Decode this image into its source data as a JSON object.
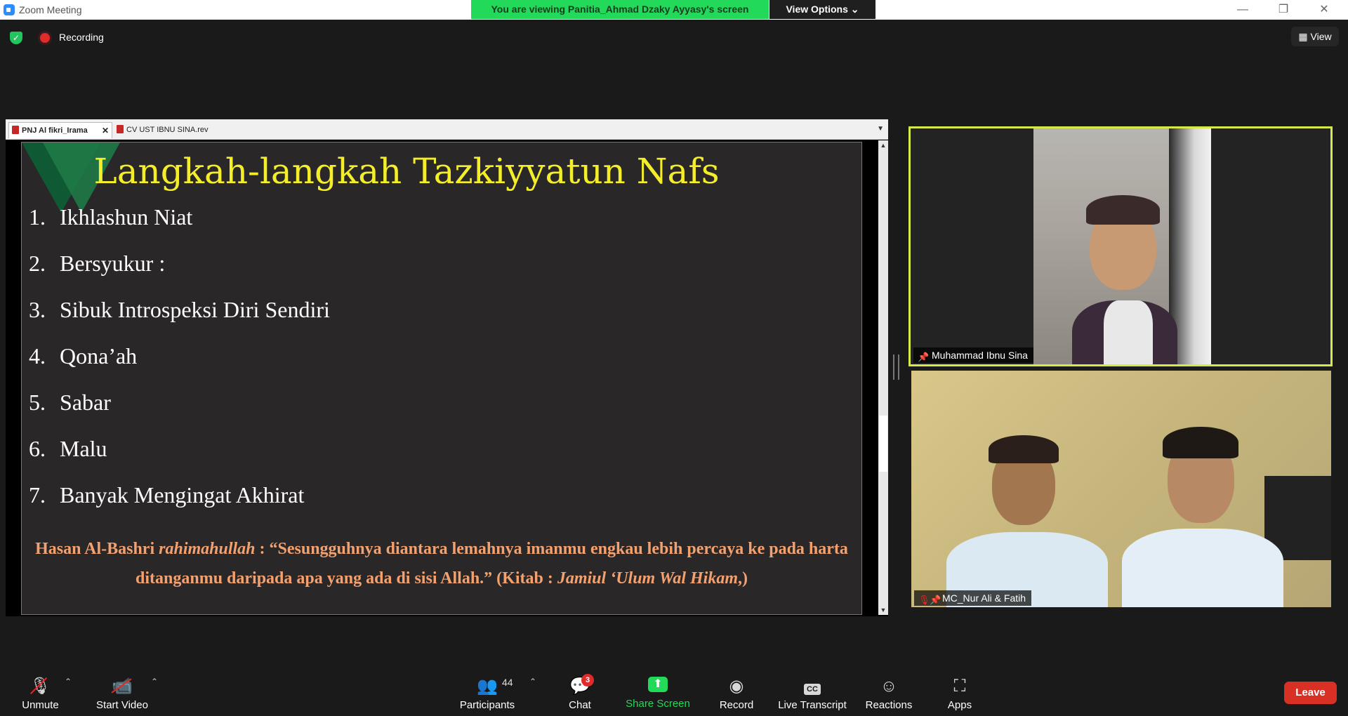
{
  "titlebar": {
    "app_title": "Zoom Meeting",
    "viewing_banner": "You are viewing Panitia_Ahmad Dzaky Ayyasy's screen",
    "view_options": "View Options ⌄",
    "minimize": "—",
    "restore": "❐",
    "close": "✕"
  },
  "topbar": {
    "recording_label": "Recording",
    "view_label": "View"
  },
  "share": {
    "tabs": [
      {
        "label": "PNJ Al fikri_Irama",
        "close": "✕"
      },
      {
        "label": "CV UST IBNU SINA.rev"
      }
    ],
    "slide": {
      "title": "Langkah-langkah Tazkiyyatun Nafs",
      "items": [
        {
          "num": "1.",
          "text": "Ikhlashun Niat"
        },
        {
          "num": "2.",
          "text": "Bersyukur :"
        },
        {
          "num": "3.",
          "text": "Sibuk Introspeksi Diri Sendiri"
        },
        {
          "num": "4.",
          "text": "Qona’ah"
        },
        {
          "num": "5.",
          "text": "Sabar"
        },
        {
          "num": "6.",
          "text": "Malu"
        },
        {
          "num": "7.",
          "text": "Banyak Mengingat Akhirat"
        }
      ],
      "quote": {
        "author": "Hasan Al-Bashri ",
        "honorific": "rahimahullah",
        "text": " : “Sesungguhnya diantara lemahnya imanmu engkau lebih percaya ke pada harta ditanganmu daripada apa yang ada di sisi Allah.” (Kitab : ",
        "book": "Jamiul ‘Ulum Wal Hikam",
        "end": ",)"
      }
    }
  },
  "videos": [
    {
      "name": "Muhammad Ibnu Sina",
      "active_speaker_color": "#d6e84a"
    },
    {
      "name": "MC_Nur Ali & Fatih",
      "muted": true
    }
  ],
  "toolbar": {
    "unmute": "Unmute",
    "start_video": "Start Video",
    "participants": "Participants",
    "participant_count": "44",
    "chat": "Chat",
    "chat_badge": "3",
    "share_screen": "Share Screen",
    "record": "Record",
    "live_transcript": "Live Transcript",
    "live_transcript_icon": "CC",
    "reactions": "Reactions",
    "apps": "Apps",
    "leave": "Leave"
  },
  "colors": {
    "accent_green": "#23d959",
    "slide_title": "#f4ee2a",
    "quote": "#f3a26f",
    "leave": "#d93025"
  }
}
